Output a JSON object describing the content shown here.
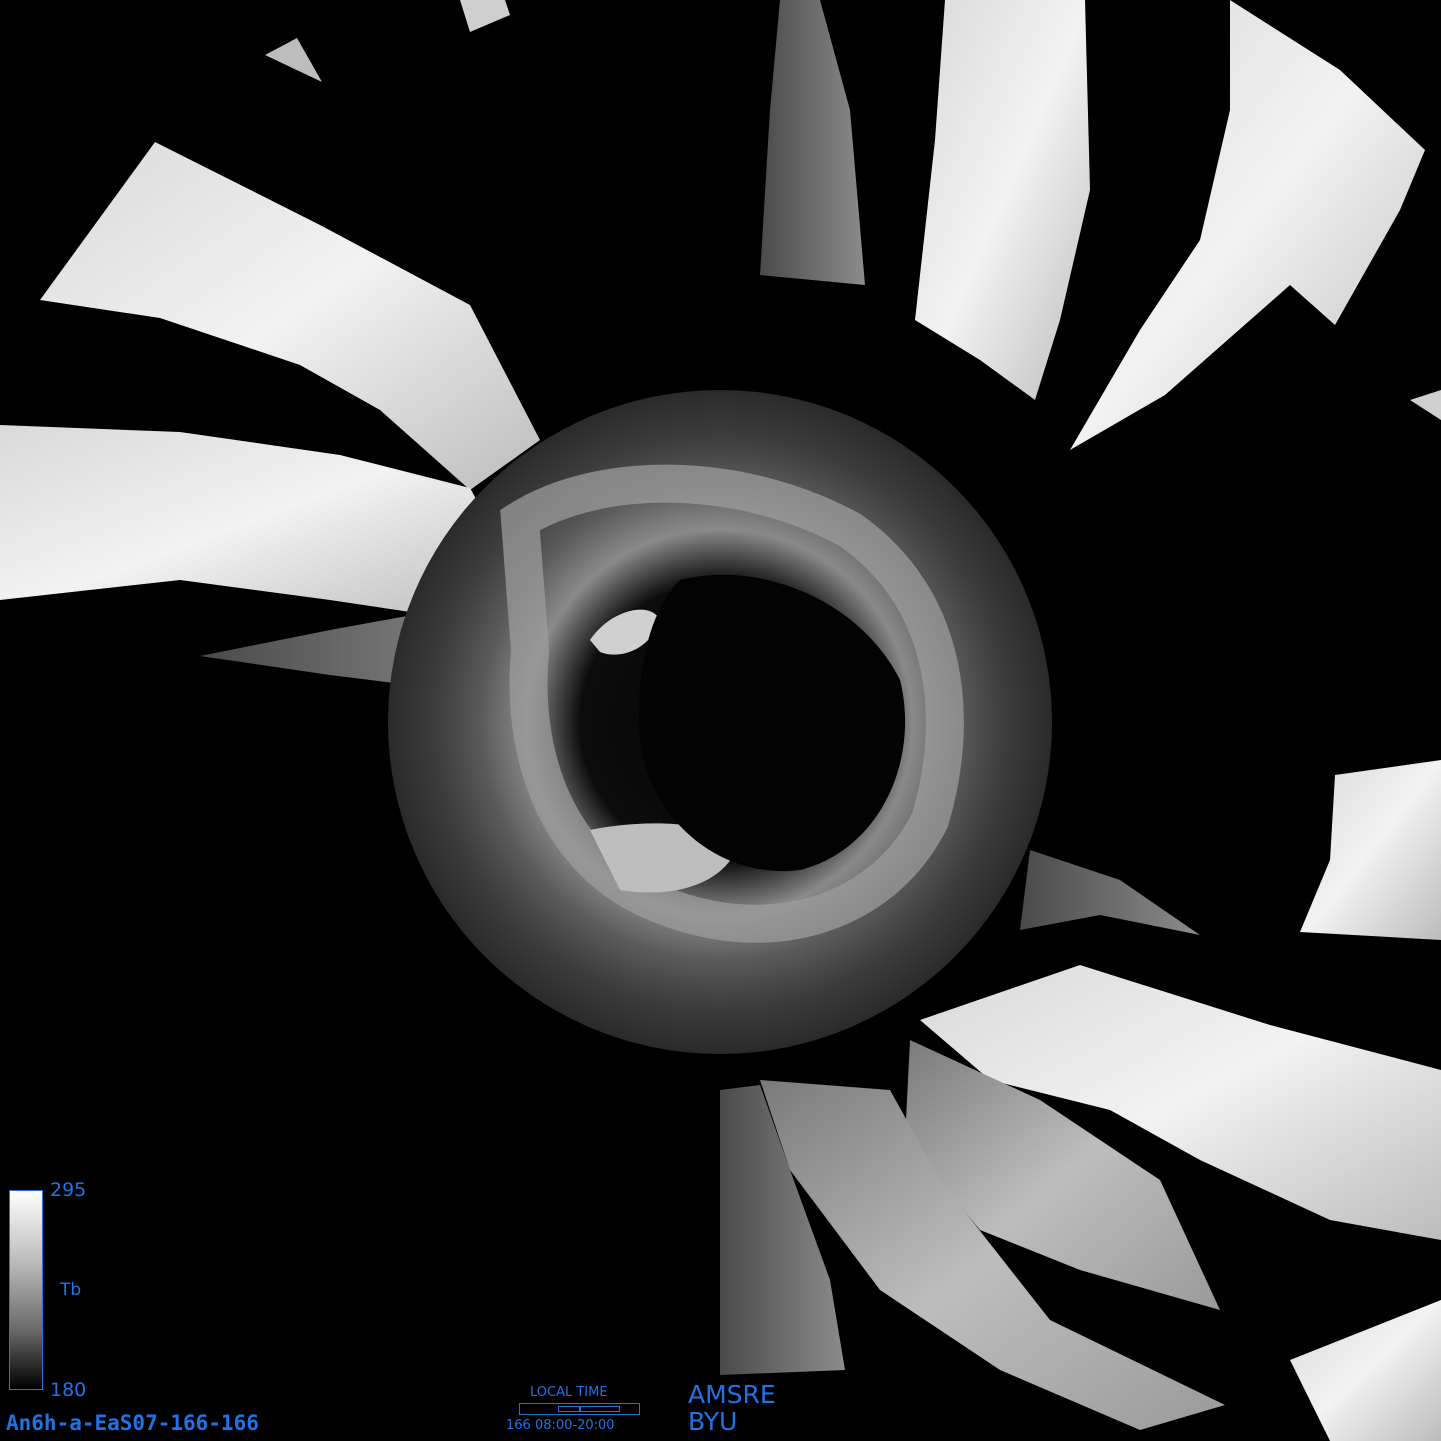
{
  "map": {
    "product_id": "An6h-a-EaS07-166-166",
    "sensor": "AMSRE",
    "institution": "BYU",
    "colorbar": {
      "variable": "Tb",
      "max": "295",
      "min": "180"
    },
    "local_time": {
      "title": "LOCAL TIME",
      "range": "166 08:00-20:00"
    }
  }
}
